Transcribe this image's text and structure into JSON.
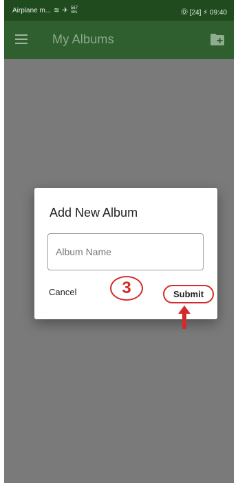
{
  "status_bar": {
    "left_text": "Airplane m...",
    "speed_top": "567",
    "speed_bottom": "B/s",
    "right_text": "Ⓞ [24] ⚡ 09:40"
  },
  "app_bar": {
    "title": "My Albums",
    "menu_icon": "hamburger-menu-icon",
    "add_icon": "add-folder-icon"
  },
  "dialog": {
    "title": "Add New Album",
    "input_placeholder": "Album Name",
    "input_value": "",
    "cancel_label": "Cancel",
    "submit_label": "Submit"
  },
  "annotation": {
    "step_number": "3",
    "accent_color": "#d32b2b"
  },
  "colors": {
    "appbar": "#2f5f2f",
    "statusbar": "#1f4b1f",
    "scrim": "#7a7a7a"
  }
}
